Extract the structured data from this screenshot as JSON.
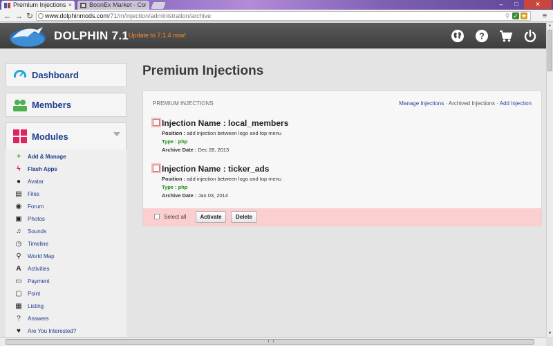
{
  "browser": {
    "tabs": [
      {
        "label": "Premium Injections",
        "active": true
      },
      {
        "label": "BoonEx Market - Co",
        "active": false
      }
    ],
    "url_host": "www.dolphinmods.com",
    "url_path": "/71/m/injection/administration/archive",
    "min_label": "–",
    "max_label": "□",
    "close_label": "✕"
  },
  "header": {
    "brand": "DOLPHIN 7.1",
    "update_text": "Update to 7.1.4 now!",
    "icons": [
      "globe-icon",
      "help-icon",
      "cart-icon",
      "power-icon"
    ]
  },
  "sidebar": {
    "dashboard": "Dashboard",
    "members": "Members",
    "modules": "Modules",
    "module_items": [
      {
        "label": "Add & Manage",
        "icon": "plus-icon",
        "bold": true
      },
      {
        "label": "Flash Apps",
        "icon": "flash-icon",
        "bold": true
      },
      {
        "label": "Avatar",
        "icon": "avatar-icon"
      },
      {
        "label": "Files",
        "icon": "files-icon"
      },
      {
        "label": "Forum",
        "icon": "forum-icon"
      },
      {
        "label": "Photos",
        "icon": "photos-icon"
      },
      {
        "label": "Sounds",
        "icon": "sounds-icon"
      },
      {
        "label": "Timeline",
        "icon": "timeline-icon"
      },
      {
        "label": "World Map",
        "icon": "map-pin-icon"
      },
      {
        "label": "Activities",
        "icon": "activities-icon"
      },
      {
        "label": "Payment",
        "icon": "payment-icon"
      },
      {
        "label": "Point",
        "icon": "point-icon"
      },
      {
        "label": "Listing",
        "icon": "listing-icon"
      },
      {
        "label": "Answers",
        "icon": "answers-icon"
      },
      {
        "label": "Are You Interested?",
        "icon": "heart-icon"
      }
    ]
  },
  "main": {
    "title": "Premium Injections",
    "panel_caption": "PREMIUM INJECTIONS",
    "links": {
      "manage": "Manage Injections",
      "archived": "Archived Injections",
      "add": "Add Injection",
      "separator": "·"
    },
    "injections": [
      {
        "name": "Injection Name : local_members",
        "position_label": "Position :",
        "position": "add injection between logo and top menu",
        "type": "Type : php",
        "date_label": "Archive Date :",
        "date": "Dec 28, 2013"
      },
      {
        "name": "Injection Name : ticker_ads",
        "position_label": "Position :",
        "position": "add injection between logo and top menu",
        "type": "Type : php",
        "date_label": "Archive Date :",
        "date": "Jan 03, 2014"
      }
    ],
    "select_all": "Select all",
    "activate": "Activate",
    "delete": "Delete"
  },
  "colors": {
    "accent_blue": "#1f3c8c",
    "update_orange": "#ff8c2a",
    "action_bar_pink": "#fbcfcf",
    "type_green": "#1a8a1a"
  }
}
